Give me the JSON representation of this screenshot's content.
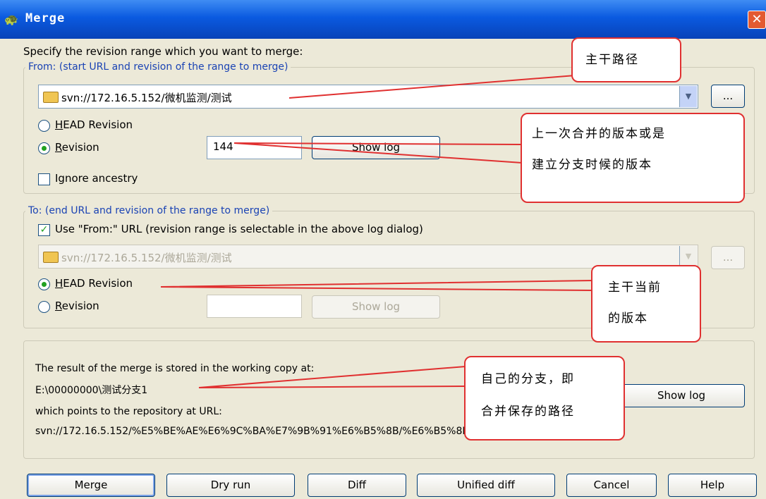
{
  "window": {
    "title": "Merge",
    "close_symbol": "✕"
  },
  "prompt": "Specify the revision range which you want to merge:",
  "from_group": {
    "legend": "From: (start URL and revision of the range to merge)",
    "url": "svn://172.16.5.152/微机监测/测试",
    "browse_label": "...",
    "head_revision_label": "HEAD Revision",
    "revision_label": "Revision",
    "revision_value": "144",
    "show_log_label": "Show log",
    "ignore_ancestry_label": "Ignore ancestry",
    "selected_option": "Revision"
  },
  "to_group": {
    "legend": "To: (end URL and revision of the range to merge)",
    "use_from_label": "Use \"From:\" URL (revision range is selectable in the above log dialog)",
    "use_from_checked": true,
    "url": "svn://172.16.5.152/微机监测/测试",
    "browse_label": "...",
    "head_revision_label": "HEAD Revision",
    "revision_label": "Revision",
    "revision_value": "",
    "show_log_label": "Show log",
    "selected_option": "HEAD Revision"
  },
  "result_group": {
    "line1": "The result of the merge is stored in the working copy at:",
    "working_copy": "E:\\00000000\\测试分支1",
    "line2": "which points to the repository at URL:",
    "repo_url": "svn://172.16.5.152/%E5%BE%AE%E6%9C%BA%E7%9B%91%E6%B5%8B/%E6%B5%8B%E8%AF%95%E5%%",
    "show_log_label": "Show log"
  },
  "buttons": {
    "merge": "Merge",
    "dry_run": "Dry run",
    "diff": "Diff",
    "unified_diff": "Unified diff",
    "cancel": "Cancel",
    "help": "Help"
  },
  "annotations": {
    "trunk_path": "主干路径",
    "last_merge_revision_1": "上一次合并的版本或是",
    "last_merge_revision_2": "建立分支时候的版本",
    "trunk_current_1": "主干当前",
    "trunk_current_2": "的版本",
    "own_branch_1": "自己的分支，即",
    "own_branch_2": "合并保存的路径"
  },
  "colors": {
    "annotation_border": "#e03030",
    "title_bar": "#0a5ae0",
    "dialog_bg": "#ece9d8"
  }
}
